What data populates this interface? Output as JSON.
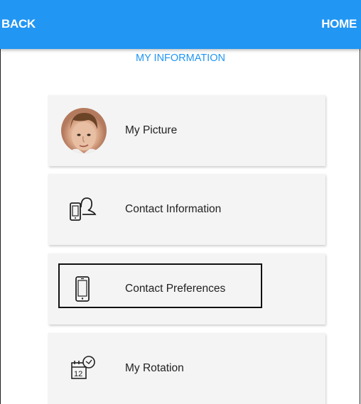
{
  "header": {
    "back_label": "BACK",
    "home_label": "HOME",
    "color": "#2196f3"
  },
  "page": {
    "title": "MY INFORMATION"
  },
  "menu": {
    "items": [
      {
        "label": "My Picture",
        "icon": "avatar-photo"
      },
      {
        "label": "Contact Information",
        "icon": "phone-person-icon"
      },
      {
        "label": "Contact Preferences",
        "icon": "mobile-phone-icon",
        "selected": true
      },
      {
        "label": "My Rotation",
        "icon": "calendar-clock-icon"
      }
    ]
  }
}
